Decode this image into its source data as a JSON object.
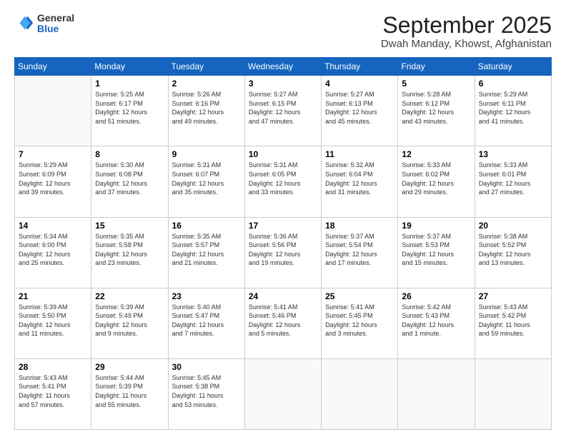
{
  "header": {
    "logo_general": "General",
    "logo_blue": "Blue",
    "title": "September 2025",
    "subtitle": "Dwah Manday, Khowst, Afghanistan"
  },
  "calendar": {
    "days_of_week": [
      "Sunday",
      "Monday",
      "Tuesday",
      "Wednesday",
      "Thursday",
      "Friday",
      "Saturday"
    ],
    "weeks": [
      [
        {
          "day": "",
          "info": ""
        },
        {
          "day": "1",
          "info": "Sunrise: 5:25 AM\nSunset: 6:17 PM\nDaylight: 12 hours\nand 51 minutes."
        },
        {
          "day": "2",
          "info": "Sunrise: 5:26 AM\nSunset: 6:16 PM\nDaylight: 12 hours\nand 49 minutes."
        },
        {
          "day": "3",
          "info": "Sunrise: 5:27 AM\nSunset: 6:15 PM\nDaylight: 12 hours\nand 47 minutes."
        },
        {
          "day": "4",
          "info": "Sunrise: 5:27 AM\nSunset: 6:13 PM\nDaylight: 12 hours\nand 45 minutes."
        },
        {
          "day": "5",
          "info": "Sunrise: 5:28 AM\nSunset: 6:12 PM\nDaylight: 12 hours\nand 43 minutes."
        },
        {
          "day": "6",
          "info": "Sunrise: 5:29 AM\nSunset: 6:11 PM\nDaylight: 12 hours\nand 41 minutes."
        }
      ],
      [
        {
          "day": "7",
          "info": "Sunrise: 5:29 AM\nSunset: 6:09 PM\nDaylight: 12 hours\nand 39 minutes."
        },
        {
          "day": "8",
          "info": "Sunrise: 5:30 AM\nSunset: 6:08 PM\nDaylight: 12 hours\nand 37 minutes."
        },
        {
          "day": "9",
          "info": "Sunrise: 5:31 AM\nSunset: 6:07 PM\nDaylight: 12 hours\nand 35 minutes."
        },
        {
          "day": "10",
          "info": "Sunrise: 5:31 AM\nSunset: 6:05 PM\nDaylight: 12 hours\nand 33 minutes."
        },
        {
          "day": "11",
          "info": "Sunrise: 5:32 AM\nSunset: 6:04 PM\nDaylight: 12 hours\nand 31 minutes."
        },
        {
          "day": "12",
          "info": "Sunrise: 5:33 AM\nSunset: 6:02 PM\nDaylight: 12 hours\nand 29 minutes."
        },
        {
          "day": "13",
          "info": "Sunrise: 5:33 AM\nSunset: 6:01 PM\nDaylight: 12 hours\nand 27 minutes."
        }
      ],
      [
        {
          "day": "14",
          "info": "Sunrise: 5:34 AM\nSunset: 6:00 PM\nDaylight: 12 hours\nand 25 minutes."
        },
        {
          "day": "15",
          "info": "Sunrise: 5:35 AM\nSunset: 5:58 PM\nDaylight: 12 hours\nand 23 minutes."
        },
        {
          "day": "16",
          "info": "Sunrise: 5:35 AM\nSunset: 5:57 PM\nDaylight: 12 hours\nand 21 minutes."
        },
        {
          "day": "17",
          "info": "Sunrise: 5:36 AM\nSunset: 5:56 PM\nDaylight: 12 hours\nand 19 minutes."
        },
        {
          "day": "18",
          "info": "Sunrise: 5:37 AM\nSunset: 5:54 PM\nDaylight: 12 hours\nand 17 minutes."
        },
        {
          "day": "19",
          "info": "Sunrise: 5:37 AM\nSunset: 5:53 PM\nDaylight: 12 hours\nand 15 minutes."
        },
        {
          "day": "20",
          "info": "Sunrise: 5:38 AM\nSunset: 5:52 PM\nDaylight: 12 hours\nand 13 minutes."
        }
      ],
      [
        {
          "day": "21",
          "info": "Sunrise: 5:39 AM\nSunset: 5:50 PM\nDaylight: 12 hours\nand 11 minutes."
        },
        {
          "day": "22",
          "info": "Sunrise: 5:39 AM\nSunset: 5:49 PM\nDaylight: 12 hours\nand 9 minutes."
        },
        {
          "day": "23",
          "info": "Sunrise: 5:40 AM\nSunset: 5:47 PM\nDaylight: 12 hours\nand 7 minutes."
        },
        {
          "day": "24",
          "info": "Sunrise: 5:41 AM\nSunset: 5:46 PM\nDaylight: 12 hours\nand 5 minutes."
        },
        {
          "day": "25",
          "info": "Sunrise: 5:41 AM\nSunset: 5:45 PM\nDaylight: 12 hours\nand 3 minutes."
        },
        {
          "day": "26",
          "info": "Sunrise: 5:42 AM\nSunset: 5:43 PM\nDaylight: 12 hours\nand 1 minute."
        },
        {
          "day": "27",
          "info": "Sunrise: 5:43 AM\nSunset: 5:42 PM\nDaylight: 11 hours\nand 59 minutes."
        }
      ],
      [
        {
          "day": "28",
          "info": "Sunrise: 5:43 AM\nSunset: 5:41 PM\nDaylight: 11 hours\nand 57 minutes."
        },
        {
          "day": "29",
          "info": "Sunrise: 5:44 AM\nSunset: 5:39 PM\nDaylight: 11 hours\nand 55 minutes."
        },
        {
          "day": "30",
          "info": "Sunrise: 5:45 AM\nSunset: 5:38 PM\nDaylight: 11 hours\nand 53 minutes."
        },
        {
          "day": "",
          "info": ""
        },
        {
          "day": "",
          "info": ""
        },
        {
          "day": "",
          "info": ""
        },
        {
          "day": "",
          "info": ""
        }
      ]
    ]
  }
}
